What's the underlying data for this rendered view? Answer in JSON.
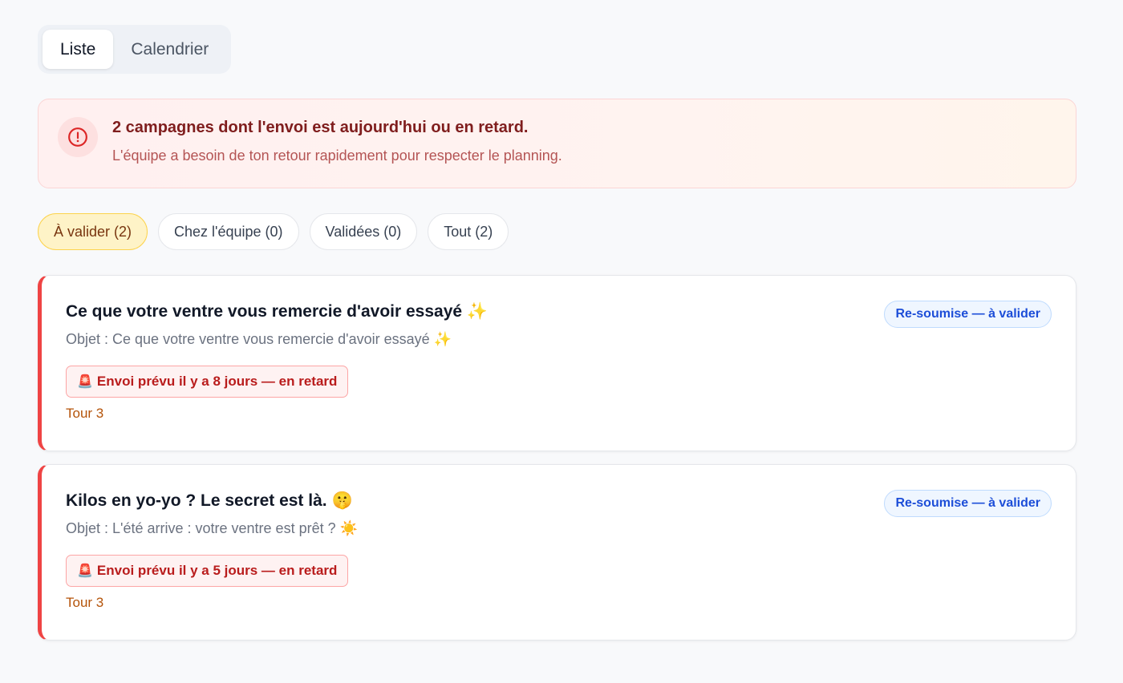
{
  "view_toggle": {
    "tabs": [
      {
        "label": "Liste",
        "active": true
      },
      {
        "label": "Calendrier",
        "active": false
      }
    ]
  },
  "alert": {
    "icon": "alert-circle-icon",
    "title": "2 campagnes dont l'envoi est aujourd'hui ou en retard.",
    "subtitle": "L'équipe a besoin de ton retour rapidement pour respecter le planning."
  },
  "filters": [
    {
      "label": "À valider (2)",
      "active": true
    },
    {
      "label": "Chez l'équipe (0)",
      "active": false
    },
    {
      "label": "Validées (0)",
      "active": false
    },
    {
      "label": "Tout (2)",
      "active": false
    }
  ],
  "campaigns": [
    {
      "title": "Ce que votre ventre vous remercie d'avoir essayé ✨",
      "subject": "Objet : Ce que votre ventre vous remercie d'avoir essayé ✨",
      "late_icon": "🚨",
      "late_label": "Envoi prévu il y a 8 jours — en retard",
      "round": "Tour 3",
      "status": "Re-soumise — à valider"
    },
    {
      "title": "Kilos en yo-yo ? Le secret est là. 🤫",
      "subject": "Objet : L'été arrive : votre ventre est prêt ? ☀️",
      "late_icon": "🚨",
      "late_label": "Envoi prévu il y a 5 jours — en retard",
      "round": "Tour 3",
      "status": "Re-soumise — à valider"
    }
  ],
  "colors": {
    "accent_red": "#ef4444",
    "alert_title": "#7f1d1d",
    "status_blue": "#1d4ed8",
    "filter_active_bg": "#fef3c7"
  }
}
